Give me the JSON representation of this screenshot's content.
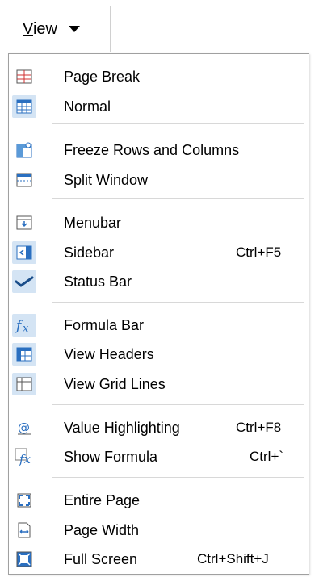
{
  "toolbar": {
    "view_label": "View"
  },
  "menu": {
    "items": [
      {
        "label": "Page Break",
        "shortcut": ""
      },
      {
        "label": "Normal",
        "shortcut": ""
      },
      {
        "label": "Freeze Rows and Columns",
        "shortcut": ""
      },
      {
        "label": "Split Window",
        "shortcut": ""
      },
      {
        "label": "Menubar",
        "shortcut": ""
      },
      {
        "label": "Sidebar",
        "shortcut": "Ctrl+F5"
      },
      {
        "label": "Status Bar",
        "shortcut": ""
      },
      {
        "label": "Formula Bar",
        "shortcut": ""
      },
      {
        "label": "View Headers",
        "shortcut": ""
      },
      {
        "label": "View Grid Lines",
        "shortcut": ""
      },
      {
        "label": "Value Highlighting",
        "shortcut": "Ctrl+F8"
      },
      {
        "label": "Show Formula",
        "shortcut": "Ctrl+`"
      },
      {
        "label": "Entire Page",
        "shortcut": ""
      },
      {
        "label": "Page Width",
        "shortcut": ""
      },
      {
        "label": "Full Screen",
        "shortcut": "Ctrl+Shift+J"
      }
    ]
  },
  "colors": {
    "accent": "#2a6fc0",
    "checked_bg": "#d4e4f4",
    "menu_border": "#a0a0a0"
  },
  "icons": [
    "page-break-icon",
    "normal-view-icon",
    "freeze-icon",
    "split-window-icon",
    "menubar-icon",
    "sidebar-icon",
    "checkmark-icon",
    "formula-bar-icon",
    "view-headers-icon",
    "grid-lines-icon",
    "value-highlighting-icon",
    "show-formula-icon",
    "entire-page-icon",
    "page-width-icon",
    "full-screen-icon"
  ]
}
